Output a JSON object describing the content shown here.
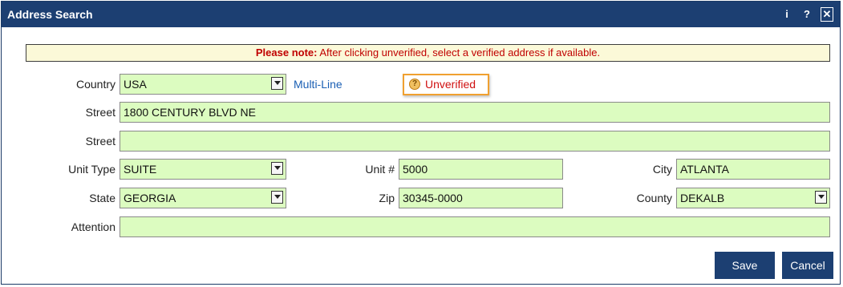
{
  "dialog": {
    "title": "Address Search",
    "info_icon": "i",
    "help_icon": "?",
    "close_icon": "✕"
  },
  "note": {
    "bold": "Please note:",
    "text": " After clicking unverified, select a verified address if available."
  },
  "form": {
    "country": {
      "label": "Country",
      "value": "USA"
    },
    "multiline_link": "Multi-Line",
    "verification_status": {
      "icon": "?",
      "label": "Unverified"
    },
    "street1": {
      "label": "Street",
      "value": "1800 CENTURY BLVD NE"
    },
    "street2": {
      "label": "Street",
      "value": ""
    },
    "unit_type": {
      "label": "Unit Type",
      "value": "SUITE"
    },
    "unit_number": {
      "label": "Unit #",
      "value": "5000"
    },
    "city": {
      "label": "City",
      "value": "ATLANTA"
    },
    "state": {
      "label": "State",
      "value": "GEORGIA"
    },
    "zip": {
      "label": "Zip",
      "value": "30345-0000"
    },
    "county": {
      "label": "County",
      "value": "DEKALB"
    },
    "attention": {
      "label": "Attention",
      "value": ""
    }
  },
  "buttons": {
    "save": "Save",
    "cancel": "Cancel"
  },
  "colors": {
    "titlebar": "#1c3f72",
    "field_bg": "#dcfcc0",
    "note_bg": "#fbf9d8",
    "note_text": "#c00000",
    "link": "#1a5fb4",
    "highlight_border": "#f0a030"
  }
}
